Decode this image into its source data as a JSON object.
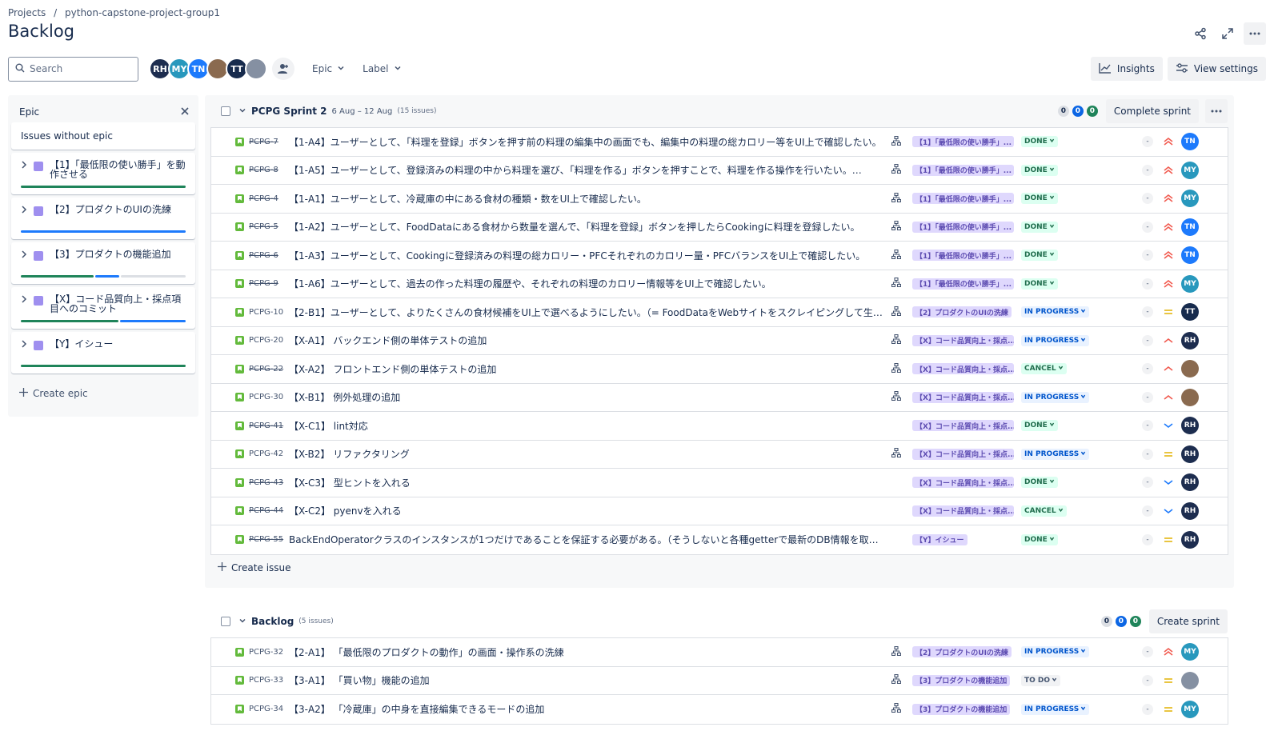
{
  "breadcrumb": {
    "projects": "Projects",
    "sep": "/",
    "project": "python-capstone-project-group1"
  },
  "title": "Backlog",
  "search": {
    "placeholder": "Search"
  },
  "avatars": [
    {
      "initials": "RH",
      "color": "#1d2d4f"
    },
    {
      "initials": "MY",
      "color": "#2898bd"
    },
    {
      "initials": "TN",
      "color": "#1d7afc"
    },
    {
      "initials": "",
      "color": "#8a6a4f"
    },
    {
      "initials": "TT",
      "color": "#172b4d"
    },
    {
      "initials": "",
      "color": "#8590a2"
    }
  ],
  "filters": {
    "epic": "Epic",
    "label": "Label"
  },
  "buttons": {
    "insights": "Insights",
    "view_settings": "View settings",
    "complete_sprint": "Complete sprint",
    "create_sprint": "Create sprint"
  },
  "epic_panel": {
    "title": "Epic",
    "no_epic": "Issues without epic",
    "items": [
      {
        "label": "【1】「最低限の使い勝手」を動作させる"
      },
      {
        "label": "【2】プロダクトのUIの洗練"
      },
      {
        "label": "【3】プロダクトの機能追加"
      },
      {
        "label": "【X】コード品質向上・採点項目へのコミット"
      },
      {
        "label": "【Y】イシュー"
      }
    ],
    "create": "Create epic"
  },
  "sprint": {
    "title": "PCPG Sprint 2",
    "dates": "6 Aug – 12 Aug",
    "count": "(15 issues)",
    "pills": [
      "0",
      "0",
      "0"
    ],
    "create_issue": "Create issue",
    "issues": [
      {
        "key": "PCPG-7",
        "done": true,
        "summary": "【1-A4】ユーザーとして、「料理を登録」ボタンを押す前の料理の編集中の画面でも、編集中の料理の総カロリー等をUI上で確認したい。",
        "epic": "【1】「最低限の使い勝手」...",
        "status": "DONE",
        "st": "done",
        "prio": "highest",
        "av": "TN",
        "avc": "#1d7afc",
        "child": true
      },
      {
        "key": "PCPG-8",
        "done": true,
        "summary": "【1-A5】ユーザーとして、登録済みの料理の中から料理を選び、「料理を作る」ボタンを押すことで、料理を作る操作を行いたい。…",
        "epic": "【1】「最低限の使い勝手」...",
        "status": "DONE",
        "st": "done",
        "prio": "highest",
        "av": "MY",
        "avc": "#2898bd",
        "child": true
      },
      {
        "key": "PCPG-4",
        "done": true,
        "summary": "【1-A1】ユーザーとして、冷蔵庫の中にある食材の種類・数をUI上で確認したい。",
        "epic": "【1】「最低限の使い勝手」...",
        "status": "DONE",
        "st": "done",
        "prio": "highest",
        "av": "MY",
        "avc": "#2898bd",
        "child": true
      },
      {
        "key": "PCPG-5",
        "done": true,
        "summary": "【1-A2】ユーザーとして、FoodDataにある食材から数量を選んで、「料理を登録」ボタンを押したらCookingに料理を登録したい。",
        "epic": "【1】「最低限の使い勝手」...",
        "status": "DONE",
        "st": "done",
        "prio": "highest",
        "av": "TN",
        "avc": "#1d7afc",
        "child": true
      },
      {
        "key": "PCPG-6",
        "done": true,
        "summary": "【1-A3】ユーザーとして、Cookingに登録済みの料理の総カロリー・PFCそれぞれのカロリー量・PFCバランスをUI上で確認したい。",
        "epic": "【1】「最低限の使い勝手」...",
        "status": "DONE",
        "st": "done",
        "prio": "highest",
        "av": "TN",
        "avc": "#1d7afc",
        "child": true
      },
      {
        "key": "PCPG-9",
        "done": true,
        "summary": "【1-A6】ユーザーとして、過去の作った料理の履歴や、それぞれの料理のカロリー情報等をUI上で確認したい。",
        "epic": "【1】「最低限の使い勝手」...",
        "status": "DONE",
        "st": "done",
        "prio": "highest",
        "av": "MY",
        "avc": "#2898bd",
        "child": true
      },
      {
        "key": "PCPG-10",
        "done": false,
        "summary": "【2-B1】ユーザーとして、よりたくさんの食材候補をUI上で選べるようにしたい。（= FoodDataをWebサイトをスクレイピングして生成する）",
        "epic": "【2】プロダクトのUIの洗練",
        "status": "IN PROGRESS",
        "st": "prog",
        "prio": "medium",
        "av": "TT",
        "avc": "#172b4d",
        "child": true
      },
      {
        "key": "PCPG-20",
        "done": false,
        "summary": "【X-A1】 バックエンド側の単体テストの追加",
        "epic": "【X】コード品質向上・採点...",
        "status": "IN PROGRESS",
        "st": "prog",
        "prio": "high",
        "av": "RH",
        "avc": "#1d2d4f",
        "child": true
      },
      {
        "key": "PCPG-22",
        "done": true,
        "summary": "【X-A2】 フロントエンド側の単体テストの追加",
        "epic": "【X】コード品質向上・採点...",
        "status": "CANCEL",
        "st": "cancel",
        "prio": "high",
        "av": "",
        "avc": "#8a6a4f",
        "child": true
      },
      {
        "key": "PCPG-30",
        "done": false,
        "summary": "【X-B1】 例外処理の追加",
        "epic": "【X】コード品質向上・採点...",
        "status": "IN PROGRESS",
        "st": "prog",
        "prio": "high",
        "av": "",
        "avc": "#8a6a4f",
        "child": true
      },
      {
        "key": "PCPG-41",
        "done": true,
        "summary": "【X-C1】 lint対応",
        "epic": "【X】コード品質向上・採点...",
        "status": "DONE",
        "st": "done",
        "prio": "low",
        "av": "RH",
        "avc": "#1d2d4f",
        "child": false
      },
      {
        "key": "PCPG-42",
        "done": false,
        "summary": "【X-B2】 リファクタリング",
        "epic": "【X】コード品質向上・採点...",
        "status": "IN PROGRESS",
        "st": "prog",
        "prio": "medium",
        "av": "RH",
        "avc": "#1d2d4f",
        "child": true
      },
      {
        "key": "PCPG-43",
        "done": true,
        "summary": "【X-C3】 型ヒントを入れる",
        "epic": "【X】コード品質向上・採点...",
        "status": "DONE",
        "st": "done",
        "prio": "low",
        "av": "RH",
        "avc": "#1d2d4f",
        "child": false
      },
      {
        "key": "PCPG-44",
        "done": true,
        "summary": "【X-C2】 pyenvを入れる",
        "epic": "【X】コード品質向上・採点...",
        "status": "CANCEL",
        "st": "cancel",
        "prio": "low",
        "av": "RH",
        "avc": "#1d2d4f",
        "child": false
      },
      {
        "key": "PCPG-55",
        "done": true,
        "summary": "BackEndOperatorクラスのインスタンスが1つだけであることを保証する必要がある。（そうしないと各種getterで最新のDB情報を取得…",
        "epic": "【Y】イシュー",
        "status": "DONE",
        "st": "done",
        "prio": "medium",
        "av": "RH",
        "avc": "#1d2d4f",
        "child": false
      }
    ]
  },
  "backlog": {
    "title": "Backlog",
    "count": "(5 issues)",
    "pills": [
      "0",
      "0",
      "0"
    ],
    "issues": [
      {
        "key": "PCPG-32",
        "done": false,
        "summary": "【2-A1】 「最低限のプロダクトの動作」の画面・操作系の洗練",
        "epic": "【2】プロダクトのUIの洗練",
        "status": "IN PROGRESS",
        "st": "prog",
        "prio": "highest",
        "av": "MY",
        "avc": "#2898bd",
        "child": true
      },
      {
        "key": "PCPG-33",
        "done": false,
        "summary": "【3-A1】 「買い物」機能の追加",
        "epic": "【3】プロダクトの機能追加",
        "status": "TO DO",
        "st": "todo",
        "prio": "medium",
        "av": "",
        "avc": "#8590a2",
        "child": true
      },
      {
        "key": "PCPG-34",
        "done": false,
        "summary": "【3-A2】 「冷蔵庫」の中身を直接編集できるモードの追加",
        "epic": "【3】プロダクトの機能追加",
        "status": "IN PROGRESS",
        "st": "prog",
        "prio": "medium",
        "av": "MY",
        "avc": "#2898bd",
        "child": true
      }
    ]
  },
  "estimate": "-",
  "colors": {
    "green": "#1f845a",
    "blue": "#1d7afc",
    "grey": "#dcdfe4"
  }
}
